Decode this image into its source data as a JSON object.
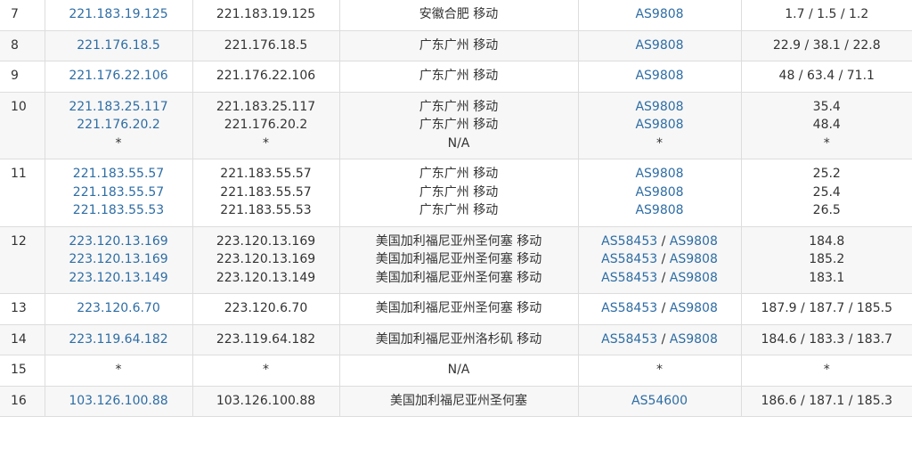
{
  "rows": [
    {
      "hop": "7",
      "ips": [
        "221.183.19.125"
      ],
      "hosts": [
        "221.183.19.125"
      ],
      "locs": [
        "安徽合肥 移动"
      ],
      "asns": [
        [
          "AS9808"
        ]
      ],
      "times": [
        "1.7 / 1.5 / 1.2"
      ]
    },
    {
      "hop": "8",
      "ips": [
        "221.176.18.5"
      ],
      "hosts": [
        "221.176.18.5"
      ],
      "locs": [
        "广东广州 移动"
      ],
      "asns": [
        [
          "AS9808"
        ]
      ],
      "times": [
        "22.9 / 38.1 / 22.8"
      ]
    },
    {
      "hop": "9",
      "ips": [
        "221.176.22.106"
      ],
      "hosts": [
        "221.176.22.106"
      ],
      "locs": [
        "广东广州 移动"
      ],
      "asns": [
        [
          "AS9808"
        ]
      ],
      "times": [
        "48 / 63.4 / 71.1"
      ]
    },
    {
      "hop": "10",
      "ips": [
        "221.183.25.117",
        "221.176.20.2",
        "*"
      ],
      "hosts": [
        "221.183.25.117",
        "221.176.20.2",
        "*"
      ],
      "locs": [
        "广东广州 移动",
        "广东广州 移动",
        "N/A"
      ],
      "asns": [
        [
          "AS9808"
        ],
        [
          "AS9808"
        ],
        [
          "*"
        ]
      ],
      "times": [
        "35.4",
        "48.4",
        "*"
      ]
    },
    {
      "hop": "11",
      "ips": [
        "221.183.55.57",
        "221.183.55.57",
        "221.183.55.53"
      ],
      "hosts": [
        "221.183.55.57",
        "221.183.55.57",
        "221.183.55.53"
      ],
      "locs": [
        "广东广州 移动",
        "广东广州 移动",
        "广东广州 移动"
      ],
      "asns": [
        [
          "AS9808"
        ],
        [
          "AS9808"
        ],
        [
          "AS9808"
        ]
      ],
      "times": [
        "25.2",
        "25.4",
        "26.5"
      ]
    },
    {
      "hop": "12",
      "ips": [
        "223.120.13.169",
        "223.120.13.169",
        "223.120.13.149"
      ],
      "hosts": [
        "223.120.13.169",
        "223.120.13.169",
        "223.120.13.149"
      ],
      "locs": [
        "美国加利福尼亚州圣何塞 移动",
        "美国加利福尼亚州圣何塞 移动",
        "美国加利福尼亚州圣何塞 移动"
      ],
      "asns": [
        [
          "AS58453",
          "AS9808"
        ],
        [
          "AS58453",
          "AS9808"
        ],
        [
          "AS58453",
          "AS9808"
        ]
      ],
      "times": [
        "184.8",
        "185.2",
        "183.1"
      ]
    },
    {
      "hop": "13",
      "ips": [
        "223.120.6.70"
      ],
      "hosts": [
        "223.120.6.70"
      ],
      "locs": [
        "美国加利福尼亚州圣何塞 移动"
      ],
      "asns": [
        [
          "AS58453",
          "AS9808"
        ]
      ],
      "times": [
        "187.9 / 187.7 / 185.5"
      ]
    },
    {
      "hop": "14",
      "ips": [
        "223.119.64.182"
      ],
      "hosts": [
        "223.119.64.182"
      ],
      "locs": [
        "美国加利福尼亚州洛杉矶 移动"
      ],
      "asns": [
        [
          "AS58453",
          "AS9808"
        ]
      ],
      "times": [
        "184.6 / 183.3 / 183.7"
      ]
    },
    {
      "hop": "15",
      "ips": [
        "*"
      ],
      "hosts": [
        "*"
      ],
      "locs": [
        "N/A"
      ],
      "asns": [
        [
          "*"
        ]
      ],
      "times": [
        "*"
      ]
    },
    {
      "hop": "16",
      "ips": [
        "103.126.100.88"
      ],
      "hosts": [
        "103.126.100.88"
      ],
      "locs": [
        "美国加利福尼亚州圣何塞"
      ],
      "asns": [
        [
          "AS54600"
        ]
      ],
      "times": [
        "186.6 / 187.1 / 185.3"
      ]
    }
  ]
}
